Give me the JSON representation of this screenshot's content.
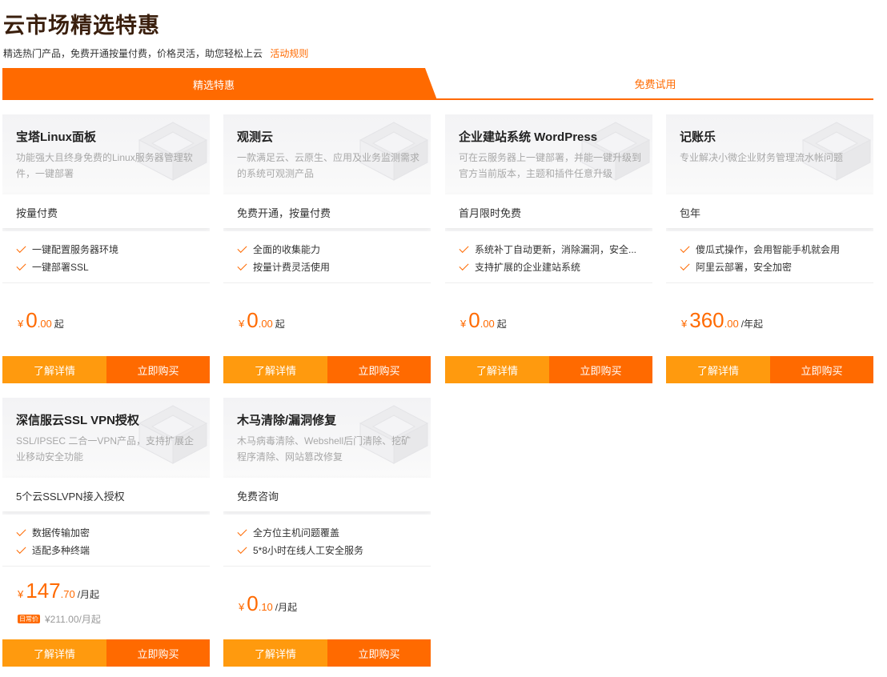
{
  "header": {
    "title": "云市场精选特惠",
    "subtitle": "精选热门产品，免费开通按量付费，价格灵活，助您轻松上云",
    "rules_link": "活动规则"
  },
  "tabs": [
    {
      "label": "精选特惠",
      "active": true
    },
    {
      "label": "免费试用",
      "active": false
    }
  ],
  "colors": {
    "accent": "#ff6a00",
    "accent_light": "#ff9a0e"
  },
  "cards": [
    {
      "title": "宝塔Linux面板",
      "desc": "功能强大且终身免费的Linux服务器管理软件，一键部署",
      "spec": "按量付费",
      "features": [
        "一键配置服务器环境",
        "一键部署SSL"
      ],
      "price": {
        "yen": "¥",
        "int": "0",
        "dec": ".00",
        "unit": "起"
      },
      "detail_label": "了解详情",
      "buy_label": "立即购买"
    },
    {
      "title": "观测云",
      "desc": "一款满足云、云原生、应用及业务监测需求的系统可观测产品",
      "spec": "免费开通，按量付费",
      "features": [
        "全面的收集能力",
        "按量计费灵活使用"
      ],
      "price": {
        "yen": "¥",
        "int": "0",
        "dec": ".00",
        "unit": "起"
      },
      "detail_label": "了解详情",
      "buy_label": "立即购买"
    },
    {
      "title": "企业建站系统 WordPress",
      "desc": "可在云服务器上一键部署，并能一键升级到官方当前版本，主题和插件任意升级",
      "spec": "首月限时免费",
      "features": [
        "系统补丁自动更新，消除漏洞，安全...",
        "支持扩展的企业建站系统"
      ],
      "price": {
        "yen": "¥",
        "int": "0",
        "dec": ".00",
        "unit": "起"
      },
      "detail_label": "了解详情",
      "buy_label": "立即购买"
    },
    {
      "title": "记账乐",
      "desc": "专业解决小微企业财务管理流水帐问题",
      "spec": "包年",
      "features": [
        "傻瓜式操作，会用智能手机就会用",
        "阿里云部署，安全加密"
      ],
      "price": {
        "yen": "¥",
        "int": "360",
        "dec": ".00",
        "unit": "/年起"
      },
      "detail_label": "了解详情",
      "buy_label": "立即购买"
    },
    {
      "title": "深信服云SSL VPN授权",
      "desc": "SSL/IPSEC 二合一VPN产品，支持扩展企业移动安全功能",
      "spec": "5个云SSLVPN接入授权",
      "features": [
        "数据传输加密",
        "适配多种终端"
      ],
      "price": {
        "yen": "¥",
        "int": "147",
        "dec": ".70",
        "unit": "/月起"
      },
      "original": {
        "badge": "日常价",
        "text": "¥211.00/月起"
      },
      "detail_label": "了解详情",
      "buy_label": "立即购买"
    },
    {
      "title": "木马清除/漏洞修复",
      "desc": "木马病毒清除、Webshell后门清除、挖矿程序清除、网站篡改修复",
      "spec": "免费咨询",
      "features": [
        "全方位主机问题覆盖",
        "5*8小时在线人工安全服务"
      ],
      "price": {
        "yen": "¥",
        "int": "0",
        "dec": ".10",
        "unit": "/月起"
      },
      "detail_label": "了解详情",
      "buy_label": "立即购买"
    }
  ]
}
